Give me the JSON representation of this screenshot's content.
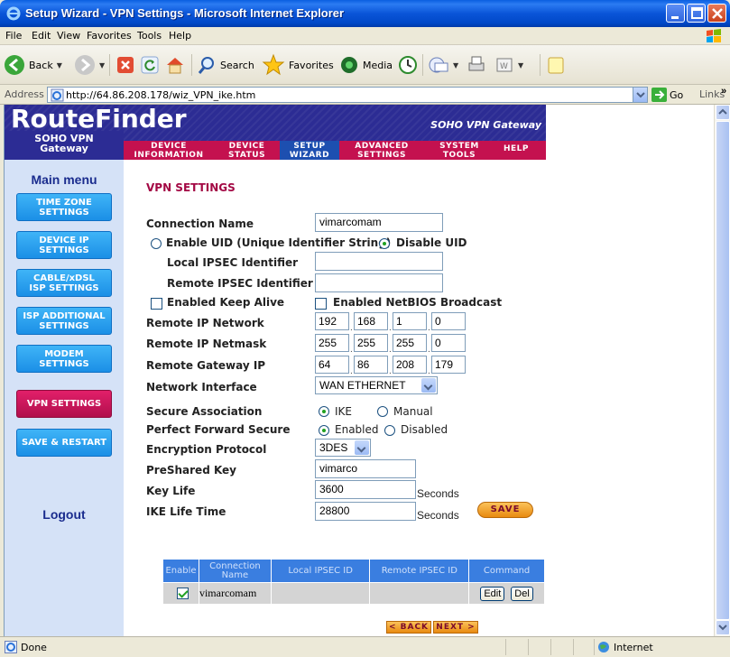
{
  "window": {
    "title": "Setup Wizard - VPN Settings - Microsoft Internet Explorer"
  },
  "menu": [
    "File",
    "Edit",
    "View",
    "Favorites",
    "Tools",
    "Help"
  ],
  "toolbar": {
    "back": "Back",
    "search": "Search",
    "favorites": "Favorites",
    "media": "Media"
  },
  "address": {
    "label": "Address",
    "url": "http://64.86.208.178/wiz_VPN_ike.htm",
    "go": "Go",
    "links": "Links"
  },
  "header": {
    "brand": "RouteFinder",
    "tagline": "SOHO VPN Gateway",
    "sub1": "SOHO VPN",
    "sub2": "Gateway"
  },
  "topnav": [
    {
      "l1": "DEVICE",
      "l2": "INFORMATION"
    },
    {
      "l1": "DEVICE",
      "l2": "STATUS"
    },
    {
      "l1": "SETUP",
      "l2": "WIZARD"
    },
    {
      "l1": "ADVANCED",
      "l2": "SETTINGS"
    },
    {
      "l1": "SYSTEM",
      "l2": "TOOLS"
    },
    {
      "l1": "HELP",
      "l2": ""
    }
  ],
  "sidebar": {
    "title": "Main menu",
    "items": [
      {
        "l1": "TIME ZONE",
        "l2": "SETTINGS"
      },
      {
        "l1": "DEVICE IP",
        "l2": "SETTINGS"
      },
      {
        "l1": "CABLE/xDSL",
        "l2": "ISP SETTINGS"
      },
      {
        "l1": "ISP ADDITIONAL",
        "l2": "SETTINGS"
      },
      {
        "l1": "MODEM",
        "l2": "SETTINGS"
      },
      {
        "l1": "VPN SETTINGS",
        "l2": ""
      },
      {
        "l1": "SAVE & RESTART",
        "l2": ""
      }
    ],
    "logout": "Logout"
  },
  "form": {
    "title": "VPN SETTINGS",
    "connection_name_label": "Connection Name",
    "connection_name": "vimarcomam",
    "enable_uid": "Enable UID (Unique Identifier String)",
    "disable_uid": "Disable UID",
    "local_id_label": "Local IPSEC Identifier",
    "local_id": "",
    "remote_id_label": "Remote IPSEC Identifier",
    "remote_id": "",
    "keepalive": "Enabled Keep Alive",
    "netbios": "Enabled NetBIOS Broadcast",
    "remote_ip_label": "Remote IP Network",
    "remote_ip": [
      "192",
      "168",
      "1",
      "0"
    ],
    "remote_mask_label": "Remote IP Netmask",
    "remote_mask": [
      "255",
      "255",
      "255",
      "0"
    ],
    "remote_gw_label": "Remote Gateway IP",
    "remote_gw": [
      "64",
      "86",
      "208",
      "179"
    ],
    "iface_label": "Network Interface",
    "iface": "WAN ETHERNET",
    "sec_assoc_label": "Secure Association",
    "ike": "IKE",
    "manual": "Manual",
    "pfs_label": "Perfect Forward Secure",
    "enabled": "Enabled",
    "disabled": "Disabled",
    "enc_label": "Encryption Protocol",
    "enc": "3DES",
    "psk_label": "PreShared Key",
    "psk": "vimarco",
    "keylife_label": "Key Life",
    "keylife": "3600",
    "ikelife_label": "IKE Life Time",
    "ikelife": "28800",
    "seconds": "Seconds",
    "save": "SAVE"
  },
  "table": {
    "headers": [
      "Enable",
      "Connection Name",
      "Local IPSEC ID",
      "Remote IPSEC ID",
      "Command"
    ],
    "rows": [
      {
        "name": "vimarcomam",
        "local": "",
        "remote": "",
        "edit": "Edit",
        "del": "Del"
      }
    ]
  },
  "wizard_nav": {
    "back": "< BACK",
    "next": "NEXT >"
  },
  "status": {
    "text": "Done",
    "zone": "Internet"
  }
}
